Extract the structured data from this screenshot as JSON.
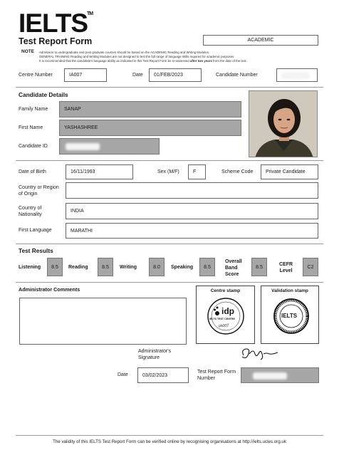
{
  "header": {
    "logo_text": "IELTS",
    "trademark": "TM",
    "form_title": "Test Report Form",
    "module": "ACADEMIC"
  },
  "note": {
    "label": "NOTE",
    "line1": "Admission to undergraduate and post graduate courses should be based on the ACADEMIC Reading and Writing Modules.",
    "line2": "GENERAL TRAINING Reading and Writing Modules are not designed to test the full range of language skills required for academic purposes.",
    "line3_start": "It is recommended that the candidate's language ability as indicated in this Test Report Form be re-assessed",
    "line3_bold": "after two years",
    "line3_end": "from the date of the test."
  },
  "centre": {
    "centre_number_label": "Centre Number",
    "centre_number": "IA007",
    "date_label": "Date",
    "date": "01/FEB/2023",
    "candidate_number_label": "Candidate Number"
  },
  "candidate": {
    "section_title": "Candidate Details",
    "family_name_label": "Family Name",
    "family_name": "SANAP",
    "first_name_label": "First Name",
    "first_name": "YASHASHREE",
    "candidate_id_label": "Candidate ID",
    "dob_label": "Date of Birth",
    "dob": "16/11/1993",
    "sex_label": "Sex (M/F)",
    "sex": "F",
    "scheme_code_label": "Scheme Code",
    "scheme_code": "Private Candidate",
    "country_origin_label_1": "Country or Region",
    "country_origin_label_2": "of Origin",
    "country_origin": "",
    "nationality_label_1": "Country of",
    "nationality_label_2": "Nationality",
    "nationality": "INDIA",
    "first_language_label": "First Language",
    "first_language": "MARATHI"
  },
  "results": {
    "section_title": "Test Results",
    "listening_label": "Listening",
    "listening": "8.5",
    "reading_label": "Reading",
    "reading": "8.5",
    "writing_label": "Writing",
    "writing": "8.0",
    "speaking_label": "Speaking",
    "speaking": "8.5",
    "overall_label_1": "Overall",
    "overall_label_2": "Band",
    "overall_label_3": "Score",
    "overall": "8.5",
    "cefr_label_1": "CEFR",
    "cefr_label_2": "Level",
    "cefr": "C2"
  },
  "admin": {
    "comments_label": "Administrator Comments",
    "centre_stamp_label": "Centre stamp",
    "validation_stamp_label": "Validation stamp",
    "centre_stamp_brand": "idp",
    "centre_stamp_ring": "IELTS TEST CENTRE",
    "centre_stamp_code": "IA007",
    "validation_stamp_text": "IELTS",
    "signature_label_1": "Administrator's",
    "signature_label_2": "Signature",
    "admin_date_label": "Date",
    "admin_date": "03/02/2023",
    "trf_number_label_1": "Test Report Form",
    "trf_number_label_2": "Number"
  },
  "footer": {
    "text": "The validity of this IELTS Test Report Form can be verified online by recognising organisations at http://ielts.ucles.org.uk"
  }
}
